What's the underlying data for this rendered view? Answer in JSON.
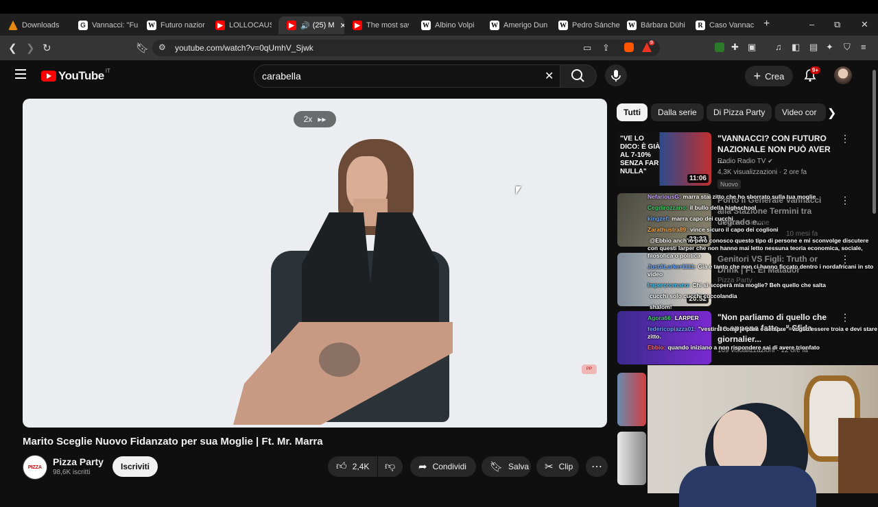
{
  "browser": {
    "tabs": [
      {
        "label": "Downloads",
        "icon": "download-icon"
      },
      {
        "label": "Vannacci: \"Fu",
        "icon": "google-news-icon"
      },
      {
        "label": "Futuro nazior",
        "icon": "wikipedia-icon"
      },
      {
        "label": "LOLLOCAUST",
        "icon": "youtube-icon"
      },
      {
        "label": "(25) M",
        "icon": "youtube-icon"
      },
      {
        "label": "The most sav",
        "icon": "youtube-icon"
      },
      {
        "label": "Albino Volpi",
        "icon": "wikipedia-icon"
      },
      {
        "label": "Amerigo Dun",
        "icon": "wikipedia-icon"
      },
      {
        "label": "Pedro Sánche",
        "icon": "wikipedia-icon"
      },
      {
        "label": "Bárbara Dühi",
        "icon": "wikipedia-icon"
      },
      {
        "label": "Caso Vannac",
        "icon": "repubblica-icon"
      }
    ],
    "url": "youtube.com/watch?v=0qUmhV_Sjwk",
    "shield_badge": "9"
  },
  "youtube": {
    "logo_text": "YouTube",
    "country_code": "IT",
    "search_query": "carabella",
    "create_label": "Crea",
    "notifications": "9+"
  },
  "player": {
    "speed_label": "2x",
    "speed_icon": "fast-forward-icon"
  },
  "video": {
    "title": "Marito Sceglie Nuovo Fidanzato per sua Moglie | Ft. Mr. Marra",
    "channel": "Pizza Party",
    "subscribers": "98,6K iscritti",
    "subscribe_label": "Iscriviti",
    "likes": "2,4K",
    "share_label": "Condividi",
    "save_label": "Salva",
    "clip_label": "Clip"
  },
  "chips": [
    "Tutti",
    "Dalla serie",
    "Di Pizza Party",
    "Video cor"
  ],
  "recommendations": [
    {
      "title": "\"VANNACCI? CON FUTURO NAZIONALE NON PUÒ AVER ...",
      "channel": "Radio Radio TV",
      "meta": "4,3K visualizzazioni · 2 ore fa",
      "badge": "Nuovo",
      "duration": "11:06",
      "thumb_text": "\"VE LO DICO: È GIÀ AL 7-10% SENZA FAR NULLA\""
    },
    {
      "title": "Porto il Generale Vannacci alla Stazione Termini tra degrado e...",
      "channel": "Cicalone Simone",
      "meta": "10 mesi fa",
      "duration": "23:33"
    },
    {
      "title": "Genitori VS Figli: Truth or Drink | Ft. El Matador",
      "channel": "Pizza Party",
      "meta": "",
      "duration": "20:52"
    },
    {
      "title": "\"Non parliamo di quello che ho appena fatto...\" Sfida giornalier...",
      "channel": "",
      "meta": "169 visualizzazioni · 12 ore fa",
      "duration": ""
    }
  ],
  "chat": [
    {
      "user": "NefariousG:",
      "text": "marra stai zitto che ho sborrato sulla tua moglie"
    },
    {
      "user": "Cegdirozzano:",
      "text": "il bullo della highschool"
    },
    {
      "user": "kingzef:",
      "text": "marra capo dei cucchi"
    },
    {
      "user": "Zarathustra89:",
      "text": "vince sicuro il capo dei coglioni"
    },
    {
      "user": "",
      "text": "@Ebbio anch'io però conosco questo tipo di persone e mi sconvolge discutere con questi larper che non hanno mai letto nessuna teoria economica, sociale, filosofica o politica"
    },
    {
      "user": "JustALurker1111:",
      "text": "Già è tanto che non ci hanno ficcato dentro i nordafricani in sto video"
    },
    {
      "user": "Imperoromano:",
      "text": "Chi si scoperà mia moglie? Beh quello che salta"
    },
    {
      "user": "",
      "text": "cucchi solo cucchi cuccolandia"
    },
    {
      "user": "",
      "text": "shalom!"
    },
    {
      "user": "Agora66:",
      "text": "LARPER"
    },
    {
      "user": "federicopiazza01:",
      "text": "\"vestirsi come le pare e sempre\"=voglio essere troia e devi stare zitto."
    },
    {
      "user": "Ebbio:",
      "text": "quando iniziano a non rispondere sai di avere trionfato"
    }
  ],
  "colors": {
    "yt_red": "#ff0000",
    "bg": "#0f0f0f",
    "chip_bg": "#272727"
  }
}
